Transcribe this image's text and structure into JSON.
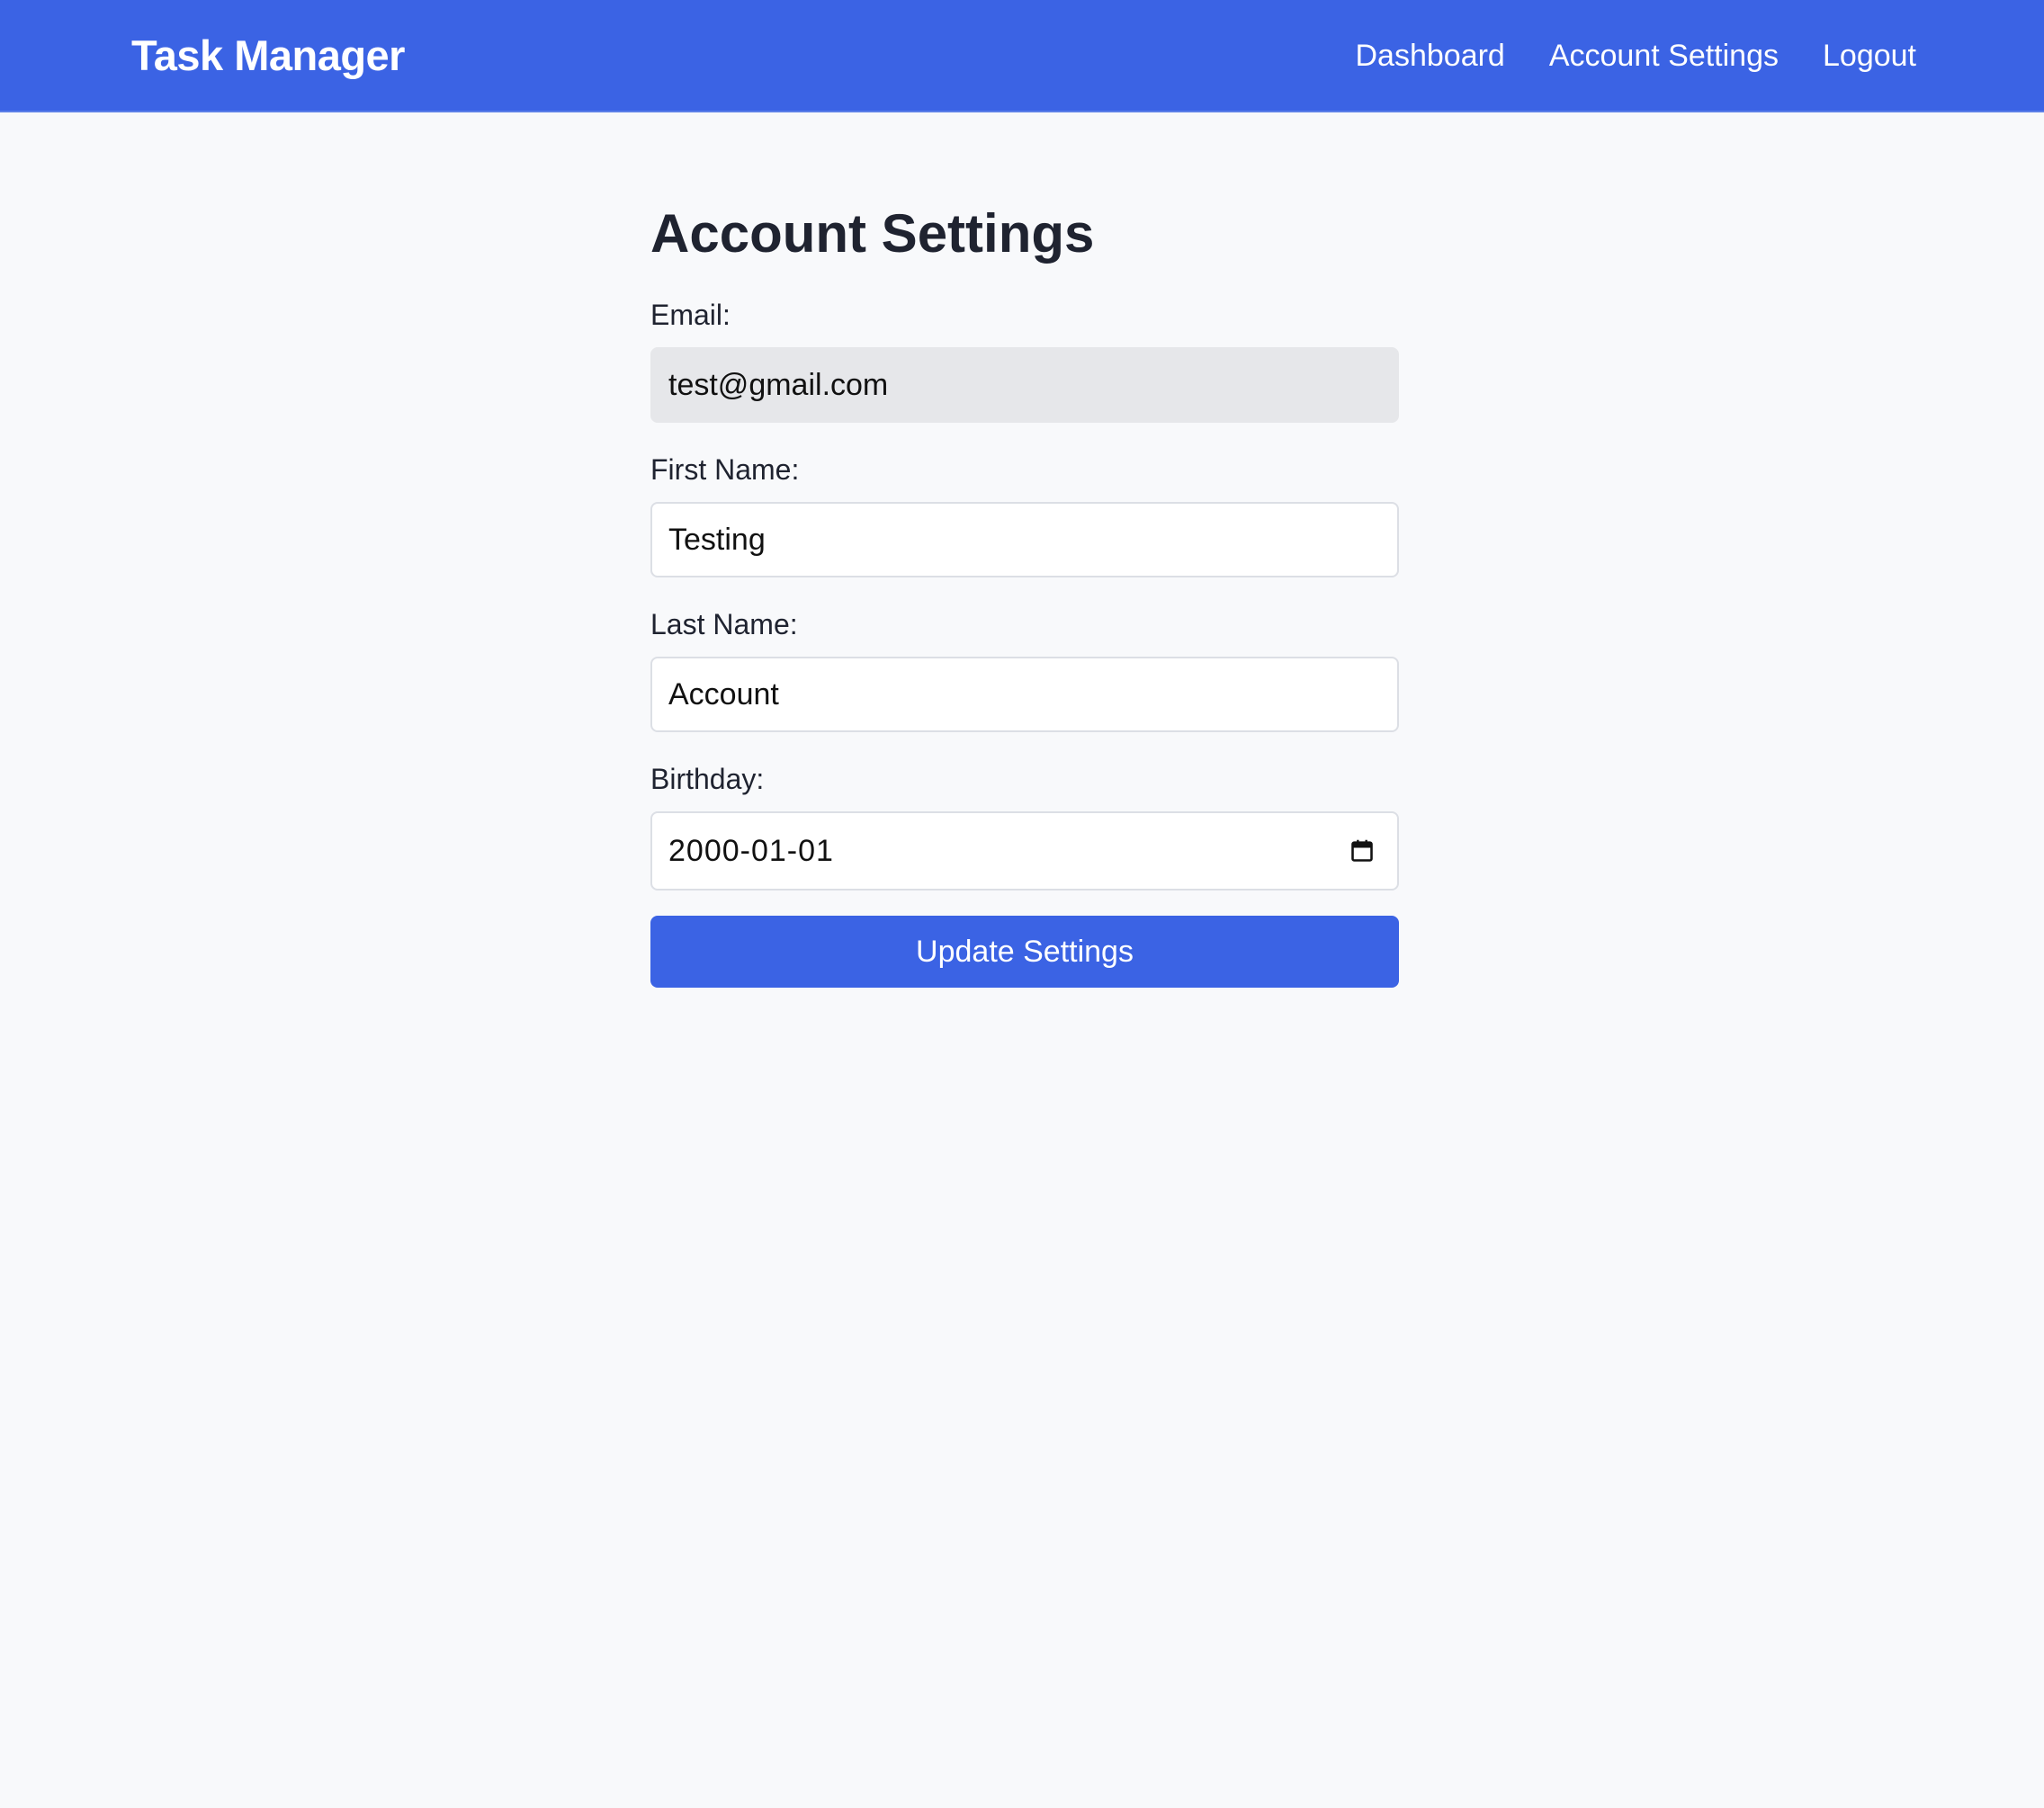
{
  "navbar": {
    "brand": "Task Manager",
    "links": [
      "Dashboard",
      "Account Settings",
      "Logout"
    ]
  },
  "page": {
    "title": "Account Settings"
  },
  "form": {
    "email": {
      "label": "Email:",
      "value": "test@gmail.com",
      "readonly": true
    },
    "first_name": {
      "label": "First Name:",
      "value": "Testing"
    },
    "last_name": {
      "label": "Last Name:",
      "value": "Account"
    },
    "birthday": {
      "label": "Birthday:",
      "value": "2000-01-01",
      "icon": "calendar-icon"
    },
    "submit_label": "Update Settings"
  },
  "colors": {
    "primary": "#3b63e4",
    "background": "#f8f9fb",
    "readonly_field": "#e6e7ea",
    "text": "#1f2330"
  }
}
